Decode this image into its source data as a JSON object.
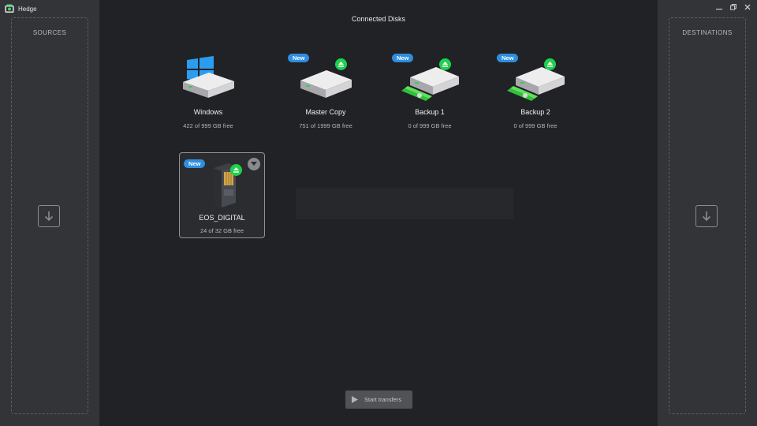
{
  "app": {
    "name": "Hedge"
  },
  "sources": {
    "title": "SOURCES",
    "icon": "arrow-down-icon"
  },
  "destinations": {
    "title": "DESTINATIONS",
    "icon": "arrow-down-icon"
  },
  "main": {
    "title": "Connected Disks"
  },
  "disks": [
    {
      "name": "Windows",
      "free": "422 of 999 GB free",
      "badge": "",
      "icon": "windows-hdd-icon",
      "eject": false
    },
    {
      "name": "Master Copy",
      "free": "751 of 1999 GB free",
      "badge": "New",
      "icon": "hdd-icon",
      "eject": true
    },
    {
      "name": "Backup 1",
      "free": "0 of 999 GB free",
      "badge": "New",
      "icon": "network-hdd-icon",
      "eject": true
    },
    {
      "name": "Backup 2",
      "free": "0 of 999 GB free",
      "badge": "New",
      "icon": "network-hdd-icon",
      "eject": true
    }
  ],
  "card": {
    "name": "EOS_DIGITAL",
    "free": "24 of 32 GB free",
    "badge": "New",
    "icon": "sd-card-icon"
  },
  "actions": {
    "start_label": "Start transfers"
  },
  "colors": {
    "accent_badge": "#2f8ee0",
    "eject_green": "#1fd14c",
    "panel": "#323438",
    "background": "#202226"
  }
}
